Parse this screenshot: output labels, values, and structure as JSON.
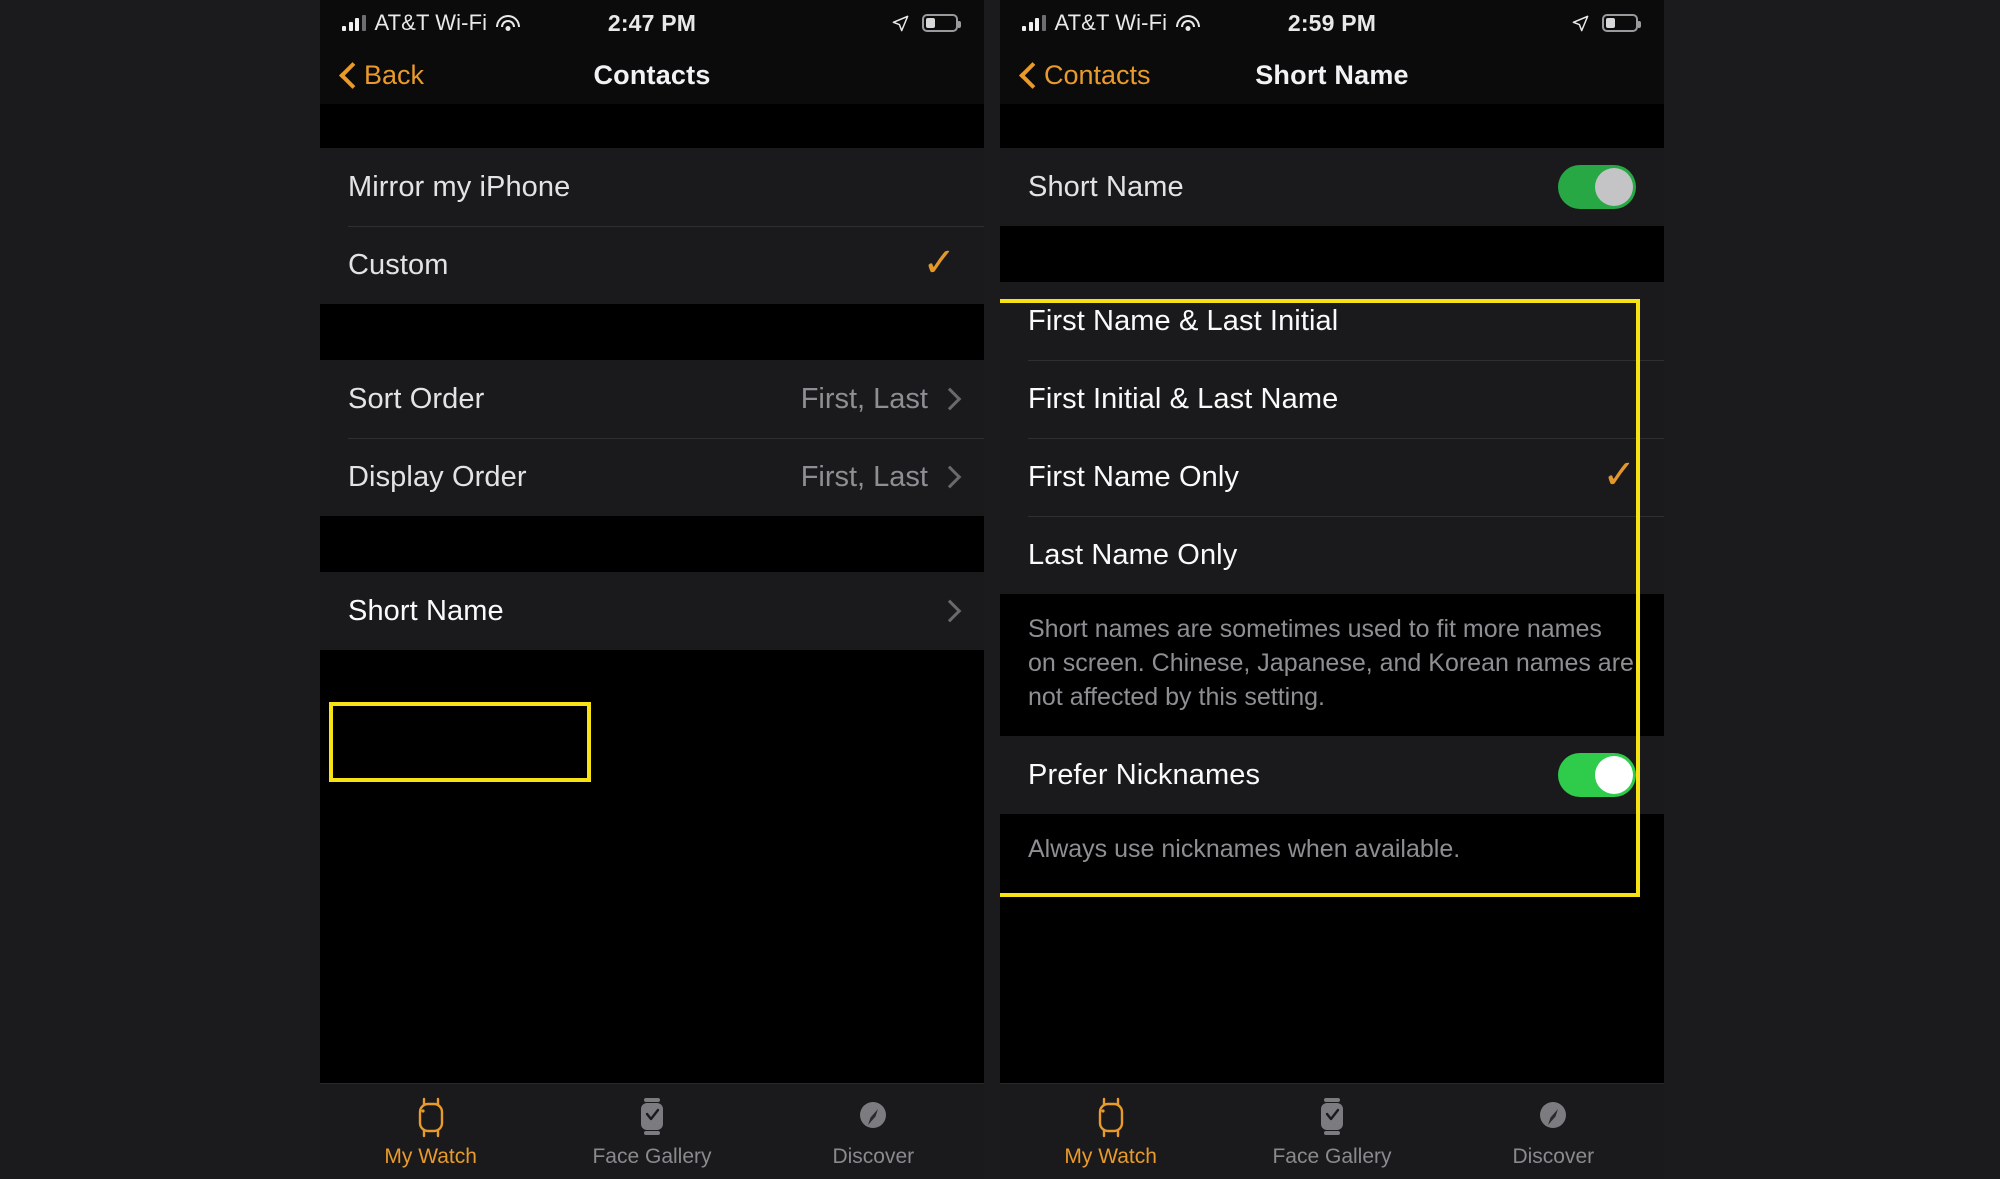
{
  "screens": [
    {
      "id": "contacts",
      "status": {
        "signal_icon": "cellular-bars-icon",
        "carrier": "AT&T Wi-Fi",
        "wifi_icon": "wifi-icon",
        "time": "2:47 PM",
        "location_icon": "location-arrow-icon",
        "battery_icon": "battery-icon"
      },
      "nav": {
        "back_icon": "chevron-left-icon",
        "back_label": "Back",
        "title": "Contacts"
      },
      "rows": [
        {
          "label": "Mirror my iPhone",
          "accessory": "none"
        },
        {
          "label": "Custom",
          "accessory": "checkmark"
        },
        {
          "label": "Sort Order",
          "value": "First, Last",
          "accessory": "chevron"
        },
        {
          "label": "Display Order",
          "value": "First, Last",
          "accessory": "chevron"
        },
        {
          "label": "Short Name",
          "value": "",
          "accessory": "chevron",
          "highlighted": true
        }
      ],
      "tabs": [
        {
          "label": "My Watch",
          "icon": "watch-icon",
          "active": true
        },
        {
          "label": "Face Gallery",
          "icon": "watch-face-icon",
          "active": false
        },
        {
          "label": "Discover",
          "icon": "compass-icon",
          "active": false
        }
      ]
    },
    {
      "id": "short-name",
      "status": {
        "signal_icon": "cellular-bars-icon",
        "carrier": "AT&T Wi-Fi",
        "wifi_icon": "wifi-icon",
        "time": "2:59 PM",
        "location_icon": "location-arrow-icon",
        "battery_icon": "battery-icon"
      },
      "nav": {
        "back_icon": "chevron-left-icon",
        "back_label": "Contacts",
        "title": "Short Name"
      },
      "short_name_toggle": {
        "label": "Short Name",
        "on": true
      },
      "options": [
        {
          "label": "First Name & Last Initial",
          "selected": false
        },
        {
          "label": "First Initial & Last Name",
          "selected": false
        },
        {
          "label": "First Name Only",
          "selected": true
        },
        {
          "label": "Last Name Only",
          "selected": false
        }
      ],
      "options_note": "Short names are sometimes used to fit more names on screen. Chinese, Japanese, and Korean names are not affected by this setting.",
      "prefer_nicknames": {
        "label": "Prefer Nicknames",
        "on": true
      },
      "nicknames_note": "Always use nicknames when available.",
      "tabs": [
        {
          "label": "My Watch",
          "icon": "watch-icon",
          "active": true
        },
        {
          "label": "Face Gallery",
          "icon": "watch-face-icon",
          "active": false
        },
        {
          "label": "Discover",
          "icon": "compass-icon",
          "active": false
        }
      ]
    }
  ],
  "colors": {
    "accent": "#e89a2c",
    "checkmark": "#e2982c",
    "toggle_on": "#28a745",
    "highlight": "#f7e214",
    "background": "#000000",
    "row": "#1a1a1c",
    "secondary_text": "#8e8e93"
  }
}
